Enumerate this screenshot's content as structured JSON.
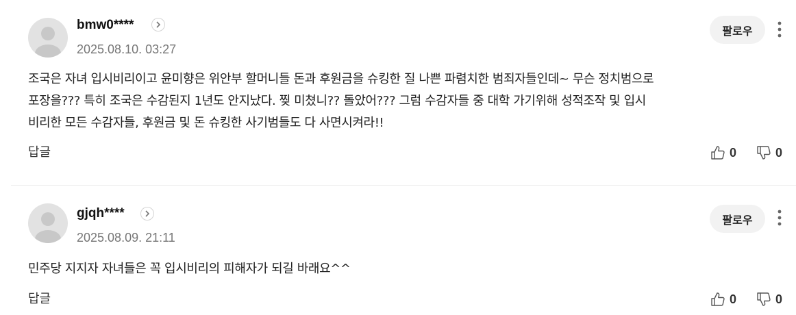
{
  "comments": [
    {
      "nickname": "bmw0****",
      "date": "2025.08.10. 03:27",
      "follow_label": "팔로우",
      "lines": [
        "조국은 자녀 입시비리이고 윤미향은 위안부 할머니들 돈과 후원금을 슈킹한 질 나쁜 파렴치한 범죄자들인데~ 무슨 정치범으로",
        "포장을??? 특히 조국은 수감된지 1년도 안지났다. 찢 미쳤니?? 돌았어??? 그럼 수감자들 중 대학 가기위해 성적조작 및 입시",
        "비리한 모든 수감자들, 후원금 및 돈 슈킹한 사기범들도 다 사면시켜라!!"
      ],
      "reply_label": "답글",
      "likes": "0",
      "dislikes": "0"
    },
    {
      "nickname": "gjqh****",
      "date": "2025.08.09. 21:11",
      "follow_label": "팔로우",
      "lines": [
        "민주당 지지자 자녀들은 꼭 입시비리의 피해자가 되길 바래요^^"
      ],
      "reply_label": "답글",
      "likes": "0",
      "dislikes": "0"
    }
  ],
  "icons": {
    "avatar": "default-avatar-icon",
    "profile": "chevron-right-icon",
    "more": "more-vertical-icon",
    "like": "thumbs-up-icon",
    "dislike": "thumbs-down-icon"
  },
  "colors": {
    "avatar_bg": "#e2e2e2",
    "avatar_fg": "#c8c8c8",
    "follow_bg": "#f2f2f2",
    "date": "#777777",
    "text": "#222222"
  }
}
